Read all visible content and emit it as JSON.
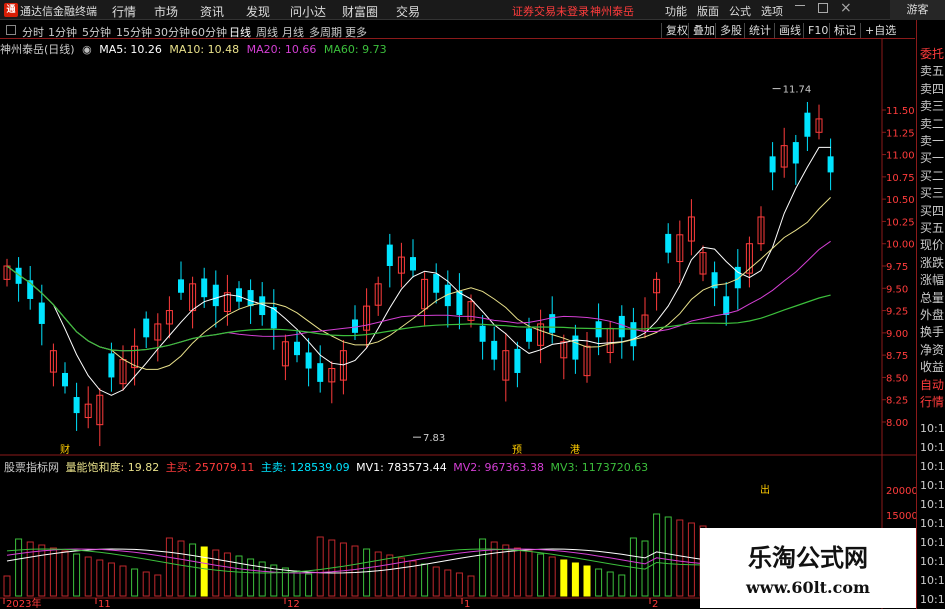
{
  "app": {
    "title": "通达信金融终端",
    "guest": "游客"
  },
  "menu": [
    "行情",
    "市场",
    "资讯",
    "发现",
    "问小达",
    "财富圈",
    "交易"
  ],
  "notice": {
    "broker": "证券交易未登录",
    "stock": "神州泰岳"
  },
  "tools": [
    "功能",
    "版面",
    "公式",
    "选项"
  ],
  "periods": [
    "分时",
    "1分钟",
    "5分钟",
    "15分钟",
    "30分钟",
    "60分钟",
    "日线",
    "周线",
    "月线",
    "多周期",
    "更多"
  ],
  "active_period": "日线",
  "right_buttons": [
    "复权",
    "叠加",
    "多股",
    "统计",
    "画线",
    "F10",
    "标记",
    "+自选"
  ],
  "stock_label": "神州泰岳(日线)",
  "ma": {
    "ma5": "MA5: 10.26",
    "ma10": "MA10: 10.48",
    "ma20": "MA20: 10.66",
    "ma60": "MA60: 9.73",
    "colors": {
      "ma5": "#ffffff",
      "ma10": "#e8e08a",
      "ma20": "#d43fd4",
      "ma60": "#3cbf3c"
    }
  },
  "sidebar": {
    "top": [
      "委托",
      "卖五",
      "卖四",
      "卖三",
      "卖二",
      "卖一",
      "买一",
      "买二",
      "买三",
      "买四",
      "买五",
      "现价",
      "涨跌",
      "涨幅",
      "总量",
      "外盘",
      "换手",
      "净资",
      "收益",
      "自动",
      "行情"
    ],
    "bottom": [
      "10:1",
      "10:1",
      "10:1",
      "10:1",
      "10:1",
      "10:1",
      "10:1",
      "10:1",
      "10:1",
      "10:1"
    ]
  },
  "price_axis": [
    "11.50",
    "11.25",
    "11.00",
    "10.75",
    "10.50",
    "10.25",
    "10.00",
    "9.75",
    "9.50",
    "9.25",
    "9.00",
    "8.75",
    "8.50",
    "8.25",
    "8.00"
  ],
  "annotations": {
    "high": "11.74",
    "low": "7.83",
    "markers": [
      "财",
      "预",
      "港"
    ],
    "out": "出"
  },
  "indicator": {
    "name": "股票指标网",
    "formula": "量能饱和度: 19.82",
    "main_buy": "主买: 257079.11",
    "main_sell": "主卖: 128539.09",
    "mv1": "MV1: 783573.44",
    "mv2": "MV2: 967363.38",
    "mv3": "MV3: 1173720.63",
    "axis": [
      "20000",
      "15000"
    ]
  },
  "date_axis": [
    "2023年",
    "11",
    "12",
    "1",
    "2"
  ],
  "watermark": {
    "title": "乐淘公式网",
    "url": "www.60lt.com"
  },
  "colors": {
    "up": "#ff3c3c",
    "down": "#00e4ff",
    "bg": "#000000"
  }
}
